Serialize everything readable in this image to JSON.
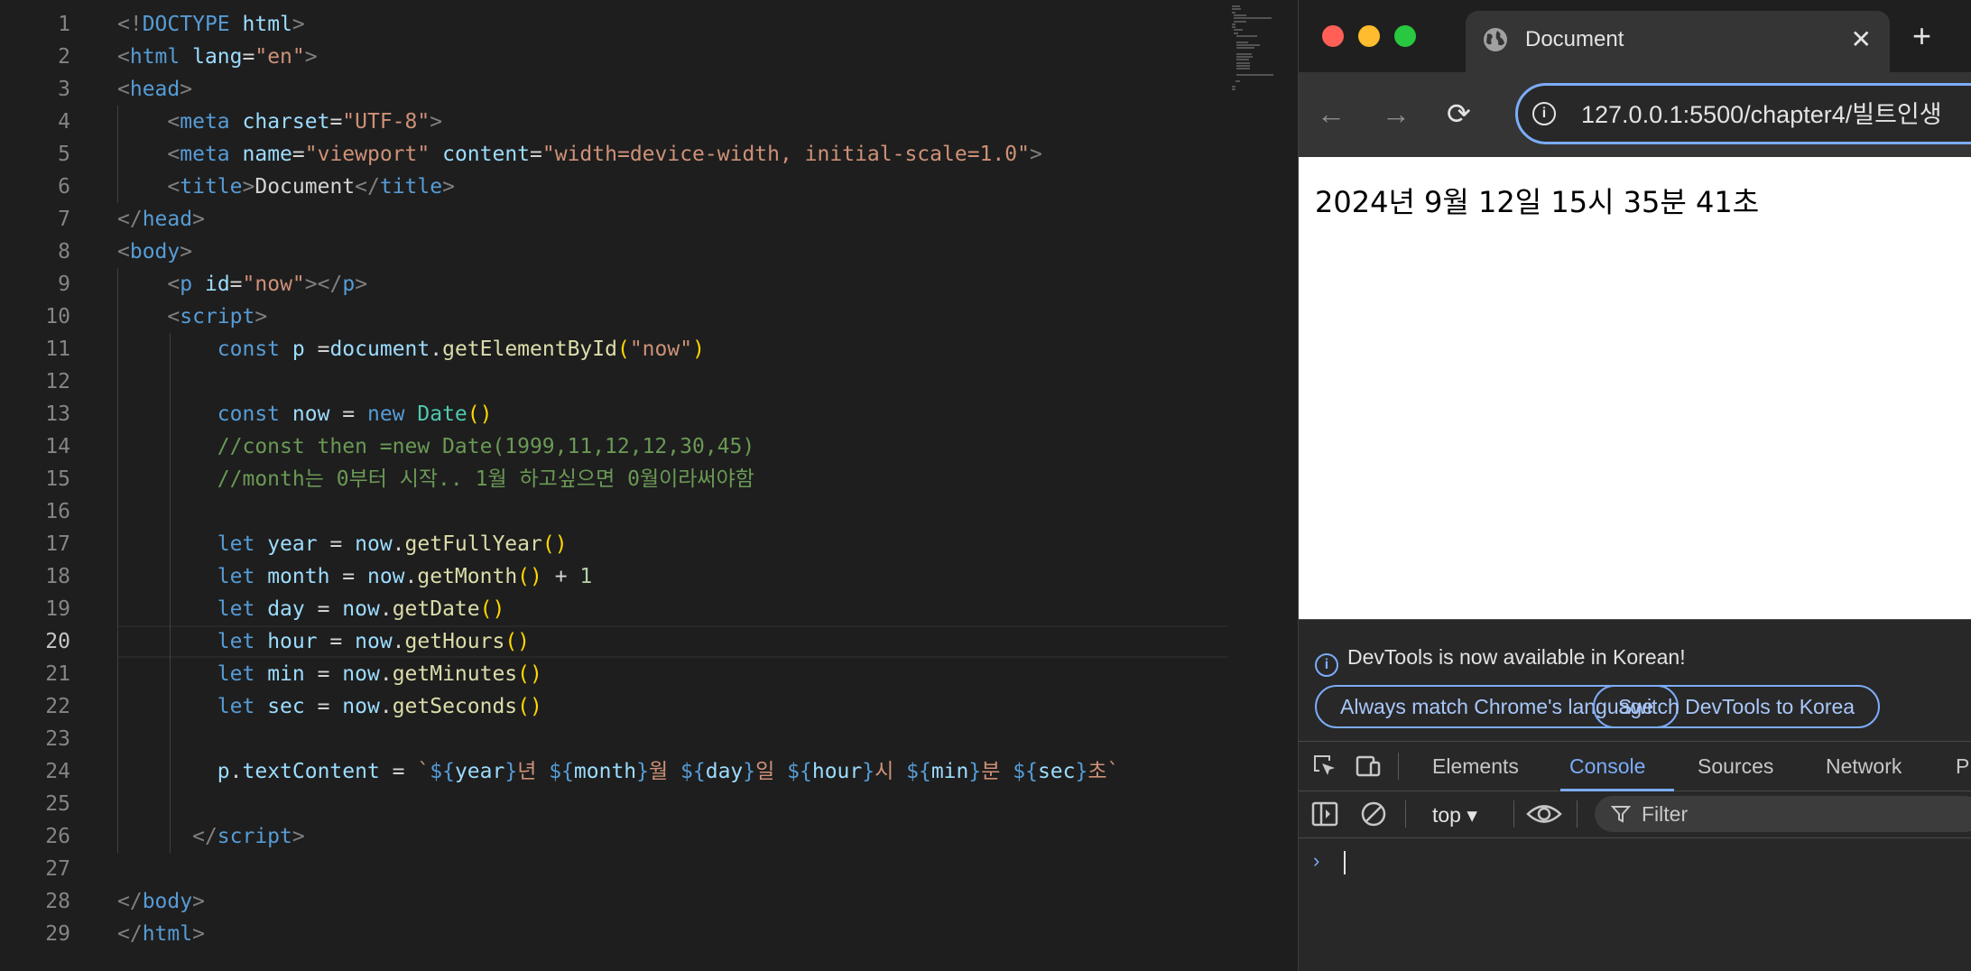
{
  "editor": {
    "line_numbers": [
      "1",
      "2",
      "3",
      "4",
      "5",
      "6",
      "7",
      "8",
      "9",
      "10",
      "11",
      "12",
      "13",
      "14",
      "15",
      "16",
      "17",
      "18",
      "19",
      "20",
      "21",
      "22",
      "23",
      "24",
      "25",
      "26",
      "27",
      "28",
      "29"
    ],
    "active_line": "20",
    "lines": [
      [
        [
          "pu",
          "<!"
        ],
        [
          "tag",
          "DOCTYPE"
        ],
        [
          "txt",
          " "
        ],
        [
          "at",
          "html"
        ],
        [
          "pu",
          ">"
        ]
      ],
      [
        [
          "pu",
          "<"
        ],
        [
          "tag",
          "html"
        ],
        [
          "txt",
          " "
        ],
        [
          "at",
          "lang"
        ],
        [
          "txt",
          "="
        ],
        [
          "st",
          "\"en\""
        ],
        [
          "pu",
          ">"
        ]
      ],
      [
        [
          "pu",
          "<"
        ],
        [
          "tag",
          "head"
        ],
        [
          "pu",
          ">"
        ]
      ],
      [
        [
          "txt",
          "    "
        ],
        [
          "pu",
          "<"
        ],
        [
          "tag",
          "meta"
        ],
        [
          "txt",
          " "
        ],
        [
          "at",
          "charset"
        ],
        [
          "txt",
          "="
        ],
        [
          "st",
          "\"UTF-8\""
        ],
        [
          "pu",
          ">"
        ]
      ],
      [
        [
          "txt",
          "    "
        ],
        [
          "pu",
          "<"
        ],
        [
          "tag",
          "meta"
        ],
        [
          "txt",
          " "
        ],
        [
          "at",
          "name"
        ],
        [
          "txt",
          "="
        ],
        [
          "st",
          "\"viewport\""
        ],
        [
          "txt",
          " "
        ],
        [
          "at",
          "content"
        ],
        [
          "txt",
          "="
        ],
        [
          "st",
          "\"width=device-width, initial-scale=1.0\""
        ],
        [
          "pu",
          ">"
        ]
      ],
      [
        [
          "txt",
          "    "
        ],
        [
          "pu",
          "<"
        ],
        [
          "tag",
          "title"
        ],
        [
          "pu",
          ">"
        ],
        [
          "txt",
          "Document"
        ],
        [
          "pu",
          "</"
        ],
        [
          "tag",
          "title"
        ],
        [
          "pu",
          ">"
        ]
      ],
      [
        [
          "pu",
          "</"
        ],
        [
          "tag",
          "head"
        ],
        [
          "pu",
          ">"
        ]
      ],
      [
        [
          "pu",
          "<"
        ],
        [
          "tag",
          "body"
        ],
        [
          "pu",
          ">"
        ]
      ],
      [
        [
          "txt",
          "    "
        ],
        [
          "pu",
          "<"
        ],
        [
          "tag",
          "p"
        ],
        [
          "txt",
          " "
        ],
        [
          "at",
          "id"
        ],
        [
          "txt",
          "="
        ],
        [
          "st",
          "\"now\""
        ],
        [
          "pu",
          "></"
        ],
        [
          "tag",
          "p"
        ],
        [
          "pu",
          ">"
        ]
      ],
      [
        [
          "txt",
          "    "
        ],
        [
          "pu",
          "<"
        ],
        [
          "tag",
          "script"
        ],
        [
          "pu",
          ">"
        ]
      ],
      [
        [
          "txt",
          "        "
        ],
        [
          "kw",
          "const"
        ],
        [
          "txt",
          " "
        ],
        [
          "var",
          "p"
        ],
        [
          "txt",
          " ="
        ],
        [
          "var",
          "document"
        ],
        [
          "txt",
          "."
        ],
        [
          "fn",
          "getElementById"
        ],
        [
          "br",
          "("
        ],
        [
          "st",
          "\"now\""
        ],
        [
          "br",
          ")"
        ]
      ],
      [
        [
          "txt",
          ""
        ]
      ],
      [
        [
          "txt",
          "        "
        ],
        [
          "kw",
          "const"
        ],
        [
          "txt",
          " "
        ],
        [
          "var",
          "now"
        ],
        [
          "txt",
          " = "
        ],
        [
          "kw",
          "new"
        ],
        [
          "txt",
          " "
        ],
        [
          "cls",
          "Date"
        ],
        [
          "br",
          "()"
        ]
      ],
      [
        [
          "txt",
          "        "
        ],
        [
          "cm",
          "//const then =new Date(1999,11,12,12,30,45)"
        ]
      ],
      [
        [
          "txt",
          "        "
        ],
        [
          "cm",
          "//month는 0부터 시작.. 1월 하고싶으면 0월이라써야함"
        ]
      ],
      [
        [
          "txt",
          ""
        ]
      ],
      [
        [
          "txt",
          "        "
        ],
        [
          "kw",
          "let"
        ],
        [
          "txt",
          " "
        ],
        [
          "var",
          "year"
        ],
        [
          "txt",
          " = "
        ],
        [
          "var",
          "now"
        ],
        [
          "txt",
          "."
        ],
        [
          "fn",
          "getFullYear"
        ],
        [
          "br",
          "()"
        ]
      ],
      [
        [
          "txt",
          "        "
        ],
        [
          "kw",
          "let"
        ],
        [
          "txt",
          " "
        ],
        [
          "var",
          "month"
        ],
        [
          "txt",
          " = "
        ],
        [
          "var",
          "now"
        ],
        [
          "txt",
          "."
        ],
        [
          "fn",
          "getMonth"
        ],
        [
          "br",
          "()"
        ],
        [
          "txt",
          " + "
        ],
        [
          "num",
          "1"
        ]
      ],
      [
        [
          "txt",
          "        "
        ],
        [
          "kw",
          "let"
        ],
        [
          "txt",
          " "
        ],
        [
          "var",
          "day"
        ],
        [
          "txt",
          " = "
        ],
        [
          "var",
          "now"
        ],
        [
          "txt",
          "."
        ],
        [
          "fn",
          "getDate"
        ],
        [
          "br",
          "()"
        ]
      ],
      [
        [
          "txt",
          "        "
        ],
        [
          "kw",
          "let"
        ],
        [
          "txt",
          " "
        ],
        [
          "var",
          "hour"
        ],
        [
          "txt",
          " = "
        ],
        [
          "var",
          "now"
        ],
        [
          "txt",
          "."
        ],
        [
          "fn",
          "getHours"
        ],
        [
          "br",
          "()"
        ]
      ],
      [
        [
          "txt",
          "        "
        ],
        [
          "kw",
          "let"
        ],
        [
          "txt",
          " "
        ],
        [
          "var",
          "min"
        ],
        [
          "txt",
          " = "
        ],
        [
          "var",
          "now"
        ],
        [
          "txt",
          "."
        ],
        [
          "fn",
          "getMinutes"
        ],
        [
          "br",
          "()"
        ]
      ],
      [
        [
          "txt",
          "        "
        ],
        [
          "kw",
          "let"
        ],
        [
          "txt",
          " "
        ],
        [
          "var",
          "sec"
        ],
        [
          "txt",
          " = "
        ],
        [
          "var",
          "now"
        ],
        [
          "txt",
          "."
        ],
        [
          "fn",
          "getSeconds"
        ],
        [
          "br",
          "()"
        ]
      ],
      [
        [
          "txt",
          ""
        ]
      ],
      [
        [
          "txt",
          "        "
        ],
        [
          "var",
          "p"
        ],
        [
          "txt",
          "."
        ],
        [
          "var",
          "textContent"
        ],
        [
          "txt",
          " = "
        ],
        [
          "st",
          "`"
        ],
        [
          "kw",
          "${"
        ],
        [
          "var",
          "year"
        ],
        [
          "kw",
          "}"
        ],
        [
          "st",
          "년 "
        ],
        [
          "kw",
          "${"
        ],
        [
          "var",
          "month"
        ],
        [
          "kw",
          "}"
        ],
        [
          "st",
          "월 "
        ],
        [
          "kw",
          "${"
        ],
        [
          "var",
          "day"
        ],
        [
          "kw",
          "}"
        ],
        [
          "st",
          "일 "
        ],
        [
          "kw",
          "${"
        ],
        [
          "var",
          "hour"
        ],
        [
          "kw",
          "}"
        ],
        [
          "st",
          "시 "
        ],
        [
          "kw",
          "${"
        ],
        [
          "var",
          "min"
        ],
        [
          "kw",
          "}"
        ],
        [
          "st",
          "분 "
        ],
        [
          "kw",
          "${"
        ],
        [
          "var",
          "sec"
        ],
        [
          "kw",
          "}"
        ],
        [
          "st",
          "초`"
        ]
      ],
      [
        [
          "txt",
          ""
        ]
      ],
      [
        [
          "txt",
          "      "
        ],
        [
          "pu",
          "</"
        ],
        [
          "tag",
          "script"
        ],
        [
          "pu",
          ">"
        ]
      ],
      [
        [
          "txt",
          ""
        ]
      ],
      [
        [
          "pu",
          "</"
        ],
        [
          "tag",
          "body"
        ],
        [
          "pu",
          ">"
        ]
      ],
      [
        [
          "pu",
          "</"
        ],
        [
          "tag",
          "html"
        ],
        [
          "pu",
          ">"
        ]
      ]
    ]
  },
  "browser": {
    "tab_title": "Document",
    "tab_close": "✕",
    "new_tab": "+",
    "back": "←",
    "forward": "→",
    "reload": "⟳",
    "info": "i",
    "url": "127.0.0.1:5500/chapter4/빌트인생",
    "page_text": "2024년 9월 12일 15시 35분 41초"
  },
  "devtools": {
    "notice": "DevTools is now available in Korean!",
    "notice_icon": "i",
    "btn_match": "Always match Chrome's language",
    "btn_switch": "Switch DevTools to Korea",
    "tabs": [
      "Elements",
      "Console",
      "Sources",
      "Network",
      "P"
    ],
    "active_tab": "Console",
    "context": "top ▾",
    "filter_placeholder": "Filter",
    "prompt": "›"
  },
  "colors": {
    "accent": "#7cacf8",
    "close_red": "#ff5f57",
    "minimize_yellow": "#febc2e",
    "zoom_green": "#28c840"
  }
}
